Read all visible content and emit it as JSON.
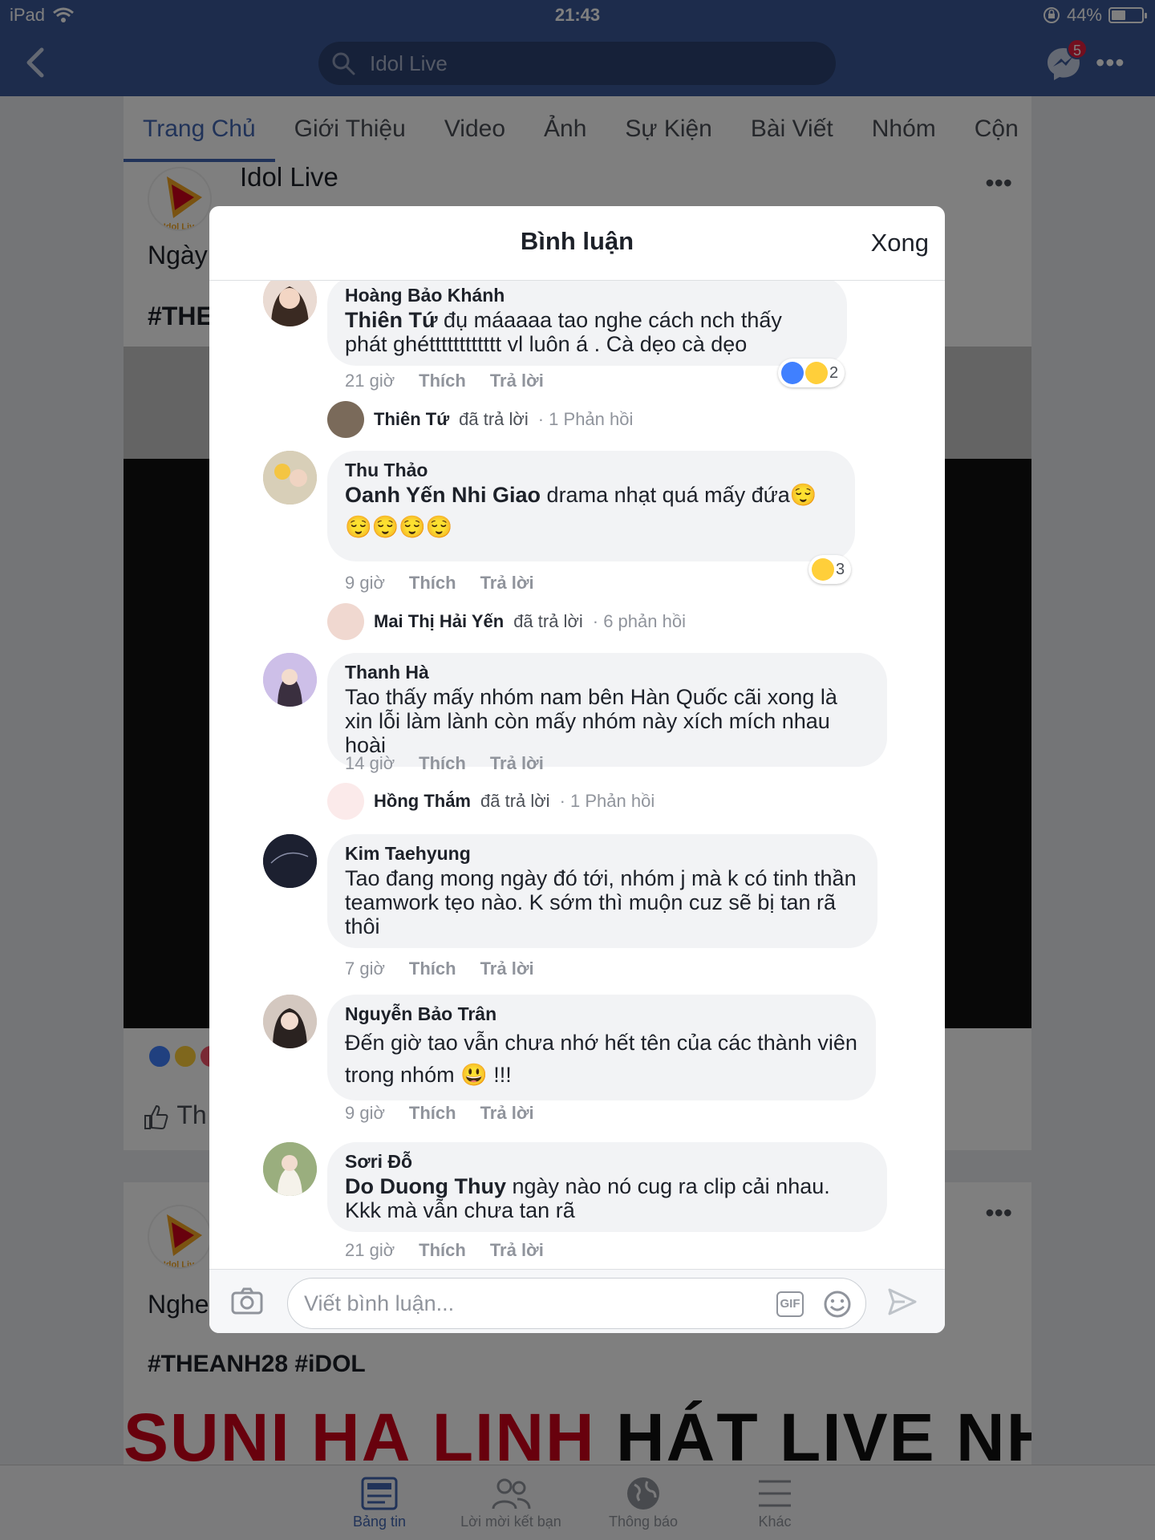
{
  "status_bar": {
    "device": "iPad",
    "time": "21:43",
    "battery": "44%"
  },
  "header": {
    "search_text": "Idol Live",
    "messenger_badge": "5"
  },
  "page_tabs": [
    "Trang Chủ",
    "Giới Thiệu",
    "Video",
    "Ảnh",
    "Sự Kiện",
    "Bài Viết",
    "Nhóm",
    "Cộn"
  ],
  "background": {
    "page_name": "Idol Live",
    "logo_text": "Idol Live",
    "post1_text_fragment": "Ngày",
    "post1_hashtag_fragment": "#THE",
    "like_fragment": "Th",
    "post2_text_fragment": "Nghe",
    "post2_hashtags": "#THEANH28 #iDOL",
    "banner_red": "SUNI HẠ LINH",
    "banner_black": "HÁT LIVE NHƯ HẾT HƠI"
  },
  "modal": {
    "title": "Bình luận",
    "done": "Xong",
    "comments": [
      {
        "author": "Hoàng Bảo Khánh",
        "tag": "Thiên Tứ",
        "text": " đụ máaaaa tao nghe cách nch thấy phát ghétttttttttttt vl luôn á . Cà dẹo cà dẹo",
        "time": "21 giờ",
        "like": "Thích",
        "reply": "Trả lời",
        "reaction_count": "2",
        "reply_author": "Thiên Tứ",
        "reply_action": "đã trả lời",
        "reply_count": "· 1 Phản hồi"
      },
      {
        "author": "Thu Thảo",
        "tag": "Oanh Yến Nhi Giao",
        "text": " drama nhạt quá mấy đứa😌",
        "text2": "😌😌😌😌",
        "time": "9 giờ",
        "like": "Thích",
        "reply": "Trả lời",
        "reaction_count": "3",
        "reply_author": "Mai Thị Hải Yến",
        "reply_action": "đã trả lời",
        "reply_count": "· 6 phản hồi"
      },
      {
        "author": "Thanh Hà",
        "text": "Tao thấy mấy nhóm nam bên Hàn Quốc cãi xong là xin lỗi làm lành còn mấy nhóm này xích mích nhau hoài",
        "time": "14 giờ",
        "like": "Thích",
        "reply": "Trả lời",
        "reply_author": "Hồng Thắm",
        "reply_action": "đã trả lời",
        "reply_count": "· 1 Phản hồi"
      },
      {
        "author": "Kim Taehyung",
        "text": "Tao đang mong ngày đó tới, nhóm j mà k có tinh thần teamwork tẹo nào. K sớm thì muộn cuz sẽ bị tan rã thôi",
        "time": "7 giờ",
        "like": "Thích",
        "reply": "Trả lời"
      },
      {
        "author": "Nguyễn Bảo Trân",
        "text": "Đến giờ tao vẫn chưa nhớ hết tên của các thành viên trong nhóm 😃 !!!",
        "time": "9 giờ",
        "like": "Thích",
        "reply": "Trả lời"
      },
      {
        "author": "Sơri Đỗ",
        "tag": "Do Duong Thuy",
        "text": " ngày nào nó cug ra clip cải nhau. Kkk mà vẫn chưa tan rã",
        "time": "21 giờ",
        "like": "Thích",
        "reply": "Trả lời"
      }
    ],
    "composer_placeholder": "Viết bình luận...",
    "gif_label": "GIF"
  },
  "bottom_nav": [
    {
      "label": "Bảng tin"
    },
    {
      "label": "Lời mời kết bạn"
    },
    {
      "label": "Thông báo"
    },
    {
      "label": "Khác"
    }
  ],
  "colors": {
    "brand": "#3b5998",
    "link": "#4267b2",
    "bubble": "#f2f3f5",
    "badge": "#e41e3f"
  }
}
